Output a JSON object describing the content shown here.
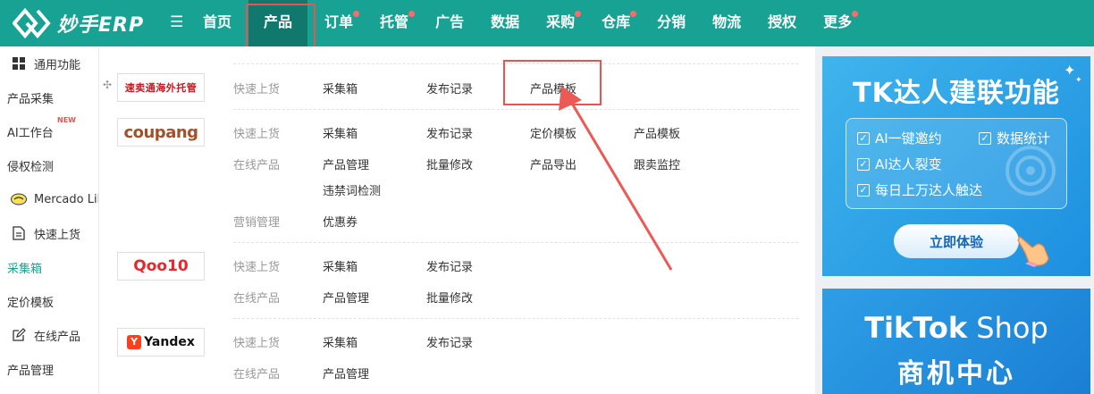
{
  "app": {
    "name": "妙手ERP"
  },
  "nav": {
    "items": [
      {
        "label": "首页",
        "dot": false
      },
      {
        "label": "产品",
        "dot": false,
        "active": true
      },
      {
        "label": "订单",
        "dot": true
      },
      {
        "label": "托管",
        "dot": true
      },
      {
        "label": "广告",
        "dot": false
      },
      {
        "label": "数据",
        "dot": false
      },
      {
        "label": "采购",
        "dot": true
      },
      {
        "label": "仓库",
        "dot": true
      },
      {
        "label": "分销",
        "dot": false
      },
      {
        "label": "物流",
        "dot": false
      },
      {
        "label": "授权",
        "dot": false
      },
      {
        "label": "更多",
        "dot": true
      }
    ]
  },
  "sidebar": {
    "items": [
      {
        "label": "通用功能",
        "icon": "grid-icon"
      },
      {
        "label": "产品采集"
      },
      {
        "label": "AI工作台",
        "badge": "NEW"
      },
      {
        "label": "侵权检测"
      },
      {
        "label": "Mercado Libre",
        "icon": "mercado-icon"
      },
      {
        "label": "快速上货",
        "icon": "document-icon"
      },
      {
        "label": "采集箱",
        "active": true
      },
      {
        "label": "定价模板"
      },
      {
        "label": "在线产品",
        "icon": "edit-icon"
      },
      {
        "label": "产品管理"
      }
    ]
  },
  "panel": {
    "platforms": [
      {
        "brand": "速卖通海外托管",
        "rows": [
          {
            "category": "快速上货",
            "links": [
              "采集箱",
              "发布记录",
              "产品模板"
            ]
          }
        ]
      },
      {
        "brand": "coupang",
        "rows": [
          {
            "category": "快速上货",
            "links": [
              "采集箱",
              "发布记录",
              "定价模板",
              "产品模板"
            ]
          },
          {
            "category": "在线产品",
            "links": [
              "产品管理",
              "批量修改",
              "产品导出",
              "跟卖监控",
              "违禁词检测"
            ]
          },
          {
            "category": "营销管理",
            "links": [
              "优惠券"
            ]
          }
        ]
      },
      {
        "brand": "Qoo10",
        "rows": [
          {
            "category": "快速上货",
            "links": [
              "采集箱",
              "发布记录"
            ]
          },
          {
            "category": "在线产品",
            "links": [
              "产品管理",
              "批量修改"
            ]
          }
        ]
      },
      {
        "brand": "Yandex",
        "brand_mark": "Y",
        "rows": [
          {
            "category": "快速上货",
            "links": [
              "采集箱",
              "发布记录"
            ]
          },
          {
            "category": "在线产品",
            "links": [
              "产品管理"
            ]
          }
        ]
      }
    ]
  },
  "ads": {
    "tk": {
      "title": "TK达人建联功能",
      "features": [
        "AI一键邀约",
        "数据统计",
        "AI达人裂变",
        "每日上万达人触达"
      ],
      "button": "立即体验"
    },
    "tiktok_shop": {
      "line1_bold": "TikTok",
      "line1_rest": " Shop",
      "line2": "商机中心"
    }
  },
  "colors": {
    "primary": "#17a294",
    "active_nav": "#10786d",
    "highlight": "#e8544f",
    "ad_blue": "#1d8fe0"
  }
}
